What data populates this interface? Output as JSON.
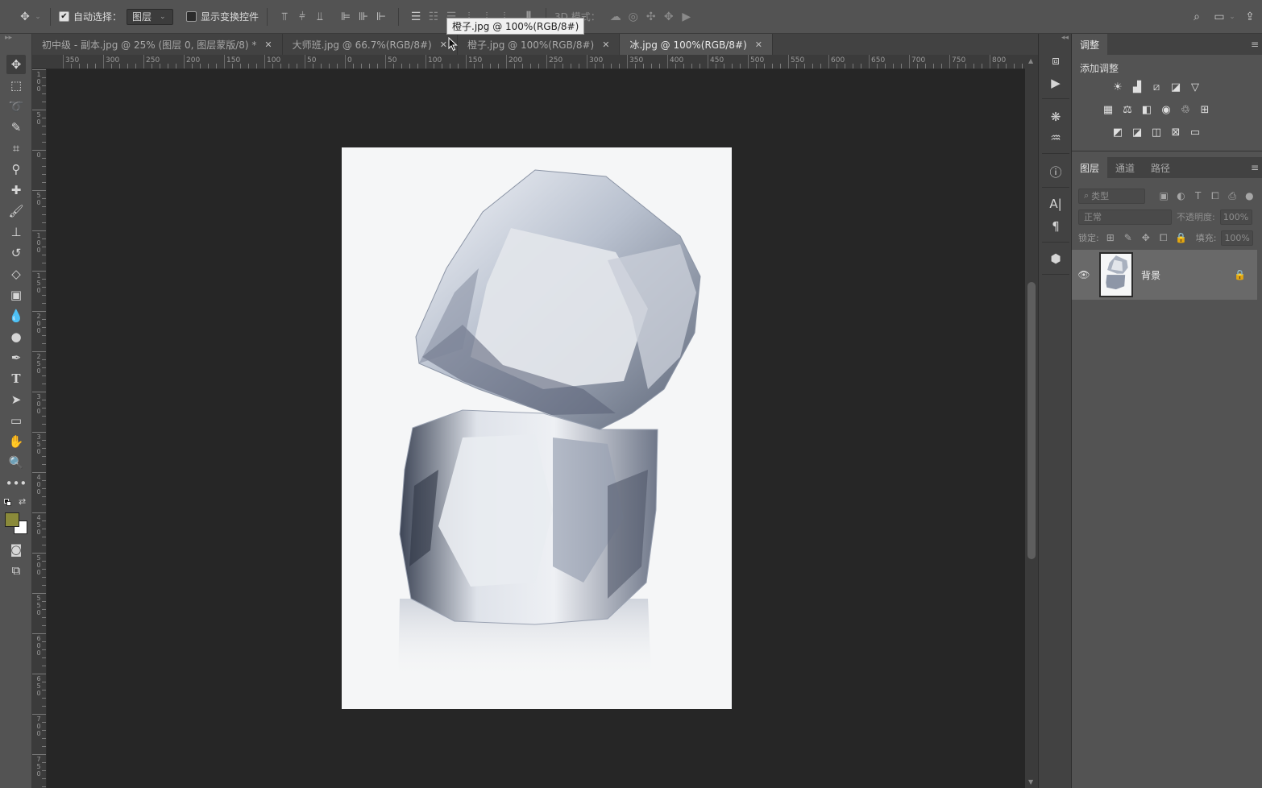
{
  "options_bar": {
    "auto_select_label": "自动选择：",
    "auto_select_target": "图层",
    "show_transform_label": "显示变换控件",
    "mode_3d_label": "3D 模式："
  },
  "tabs": [
    {
      "label": "初中级 - 副本.jpg @ 25% (图层 0, 图层蒙版/8) *",
      "active": false
    },
    {
      "label": "大师班.jpg @ 66.7%(RGB/8#)",
      "active": false
    },
    {
      "label": "橙子.jpg @ 100%(RGB/8#)",
      "active": false
    },
    {
      "label": "冰.jpg @ 100%(RGB/8#)",
      "active": true
    }
  ],
  "tooltip": "橙子.jpg @ 100%(RGB/8#)",
  "ruler": {
    "top_labels": [
      "350",
      "300",
      "250",
      "200",
      "150",
      "100",
      "50",
      "0",
      "50",
      "100",
      "150",
      "200",
      "250",
      "300",
      "350",
      "400",
      "450",
      "500",
      "550",
      "600",
      "650",
      "700",
      "750",
      "800"
    ],
    "left_labels": [
      "100",
      "50",
      "0",
      "50",
      "100",
      "150",
      "200",
      "250",
      "300",
      "350",
      "400",
      "450",
      "500",
      "550",
      "600",
      "650",
      "700",
      "750"
    ]
  },
  "colors": {
    "foreground": "#8a8a3a",
    "background": "#ffffff"
  },
  "adjustments_panel": {
    "tab": "调整",
    "title": "添加调整"
  },
  "layers_panel": {
    "tabs": [
      "图层",
      "通道",
      "路径"
    ],
    "filter_placeholder": "类型",
    "blend_mode": "正常",
    "opacity_label": "不透明度:",
    "opacity_value": "100%",
    "lock_label": "锁定:",
    "fill_label": "填充:",
    "fill_value": "100%",
    "layers": [
      {
        "name": "背景",
        "visible": true,
        "locked": true
      }
    ]
  }
}
